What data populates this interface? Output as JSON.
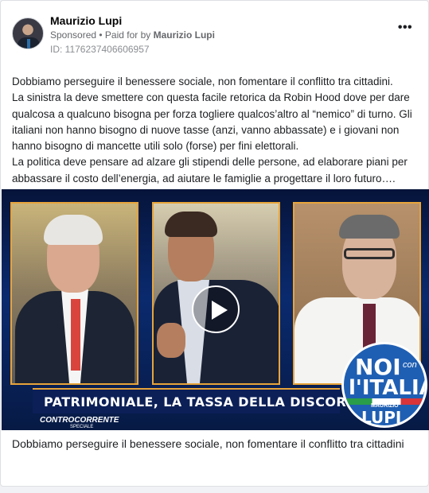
{
  "post": {
    "author": "Maurizio Lupi",
    "sponsored_label": "Sponsored",
    "separator": " • ",
    "paid_for_prefix": "Paid for by ",
    "paid_for_name": "Maurizio Lupi",
    "ad_id": "ID: 1176237406606957",
    "more_icon": "more-horizontal-icon",
    "more_glyph": "•••",
    "text_lines": [
      "Dobbiamo perseguire il benessere sociale, non fomentare il conflitto tra cittadini.",
      "La sinistra la deve smettere con questa facile retorica da Robin Hood dove per dare qualcosa a qualcuno bisogna per forza togliere qualcos’altro al “nemico” di turno. Gli italiani non hanno bisogno di nuove tasse (anzi, vanno abbassate) e i giovani non hanno bisogno di mancette utili solo (forse) per fini elettorali.",
      "La politica deve pensare ad alzare gli stipendi delle persone, ad elaborare piani per abbassare il costo dell’energia, ad aiutare le famiglie a progettare il loro futuro…."
    ]
  },
  "video": {
    "banner": "PATRIMONIALE, LA TASSA DELLA DISCORDIA",
    "show_name": "CONTROCORRENTE",
    "show_sub": "SPECIALE",
    "play_icon": "play-icon",
    "logo": {
      "noi": "NOI",
      "con": "con",
      "italia": "l'ITALIA",
      "maurizio": "MAURIZIO",
      "lupi": "LUPI"
    }
  },
  "caption": "Dobbiamo perseguire il benessere sociale, non fomentare il conflitto tra cittadini",
  "colors": {
    "accent_frame": "#e7a43a",
    "banner_bg": "#0c1f57",
    "logo_blue": "#1f5fb3",
    "meta_gray": "#65676b"
  }
}
